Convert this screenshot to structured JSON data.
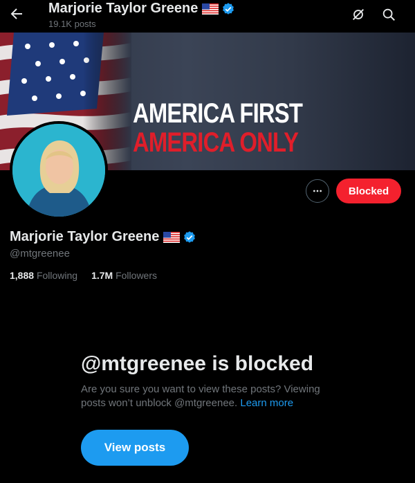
{
  "header": {
    "back_icon": "arrow-left-icon",
    "title": "Marjorie Taylor Greene",
    "posts_count": "19.1K posts",
    "actions": [
      "no-signal-icon",
      "search-icon"
    ]
  },
  "banner": {
    "line1": "AMERICA FIRST",
    "line2": "AMERICA ONLY",
    "colors": {
      "line1": "#ffffff",
      "line2": "#e01e2a"
    }
  },
  "profile": {
    "name": "Marjorie Taylor Greene",
    "handle": "@mtgreenee",
    "following_count": "1,888",
    "following_label": "Following",
    "followers_count": "1.7M",
    "followers_label": "Followers"
  },
  "actions": {
    "more_icon": "more-horizontal-icon",
    "blocked_label": "Blocked"
  },
  "blocked_notice": {
    "title": "@mtgreenee is blocked",
    "text": "Are you sure you want to view these posts? Viewing posts won’t unblock @mtgreenee.",
    "link": "Learn more",
    "button": "View posts"
  },
  "colors": {
    "accent": "#1d9bf0",
    "blocked": "#f4212e",
    "muted_text": "#71767b",
    "text": "#e7e9ea"
  }
}
